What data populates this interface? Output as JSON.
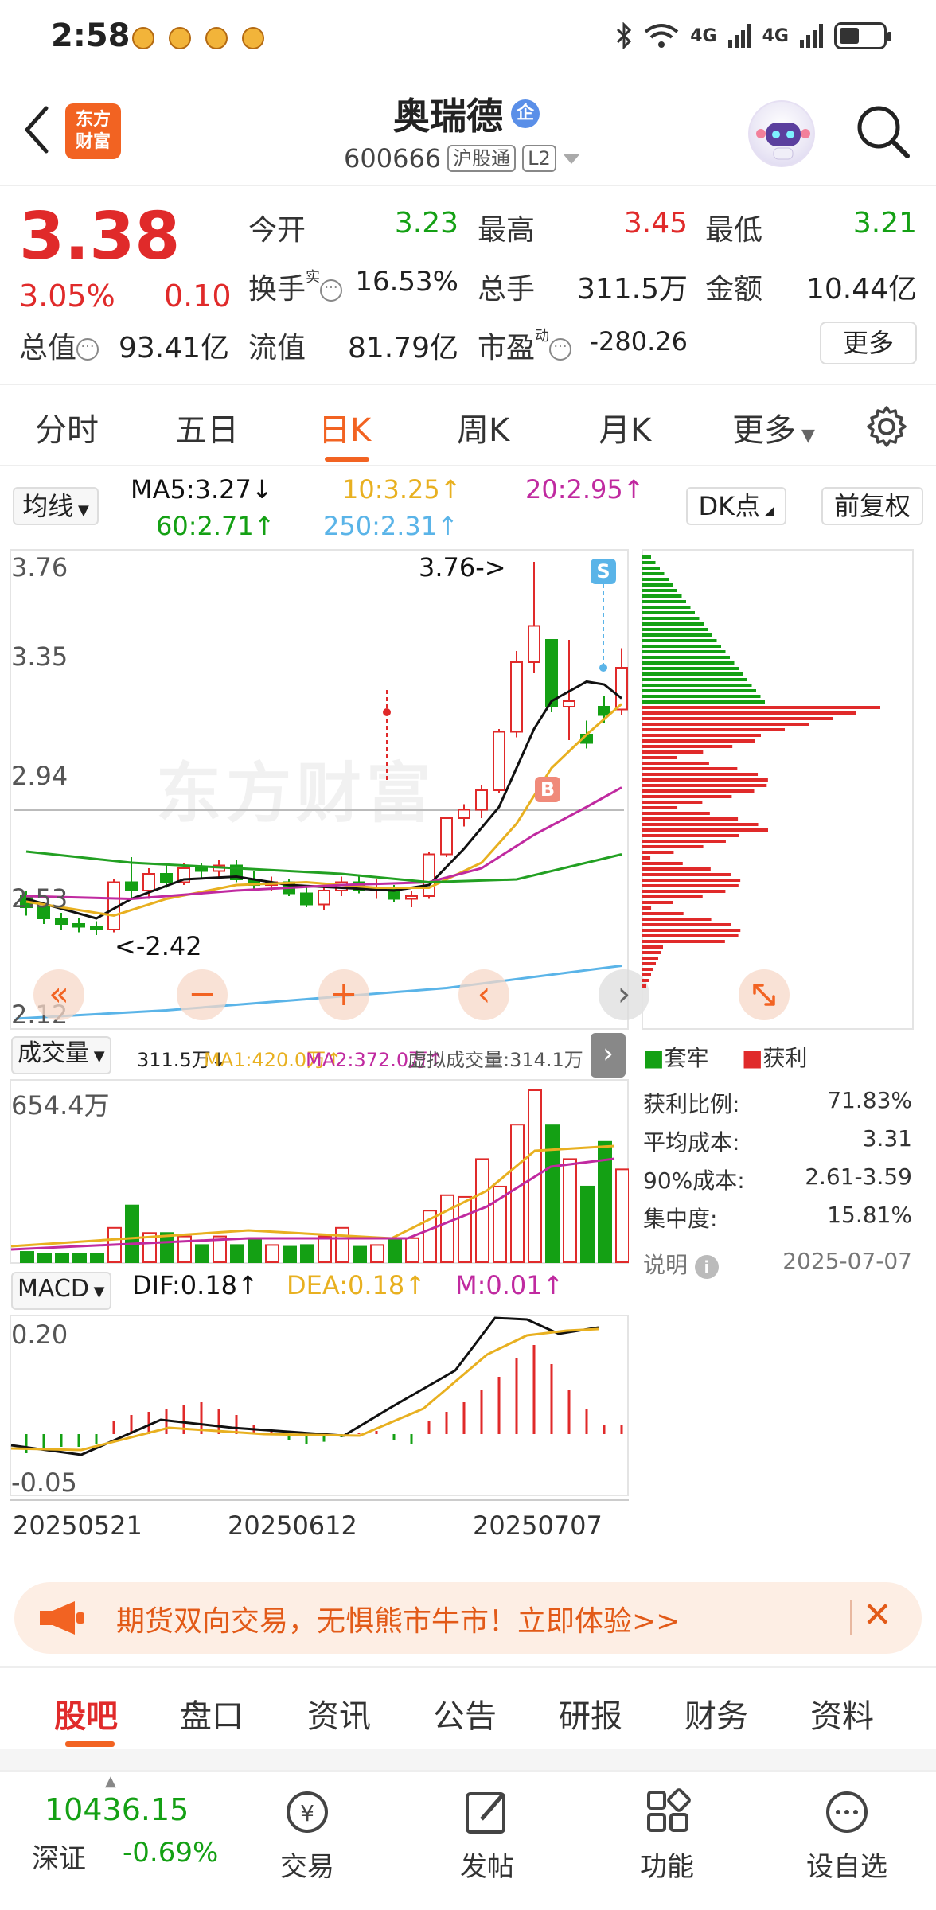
{
  "status_bar": {
    "time": "2:58",
    "signal_1": "4G",
    "signal_2": "4G"
  },
  "header": {
    "logo_line1": "东方",
    "logo_line2": "财富",
    "stock_name": "奥瑞德",
    "badge": "企",
    "stock_code": "600666",
    "tag_connect": "沪股通",
    "tag_level": "L2"
  },
  "quote": {
    "price": "3.38",
    "change_pct": "3.05%",
    "change": "0.10",
    "open_label": "今开",
    "open": "3.23",
    "high_label": "最高",
    "high": "3.45",
    "low_label": "最低",
    "low": "3.21",
    "turnover_label": "换手",
    "turnover_sup": "实",
    "turnover": "16.53%",
    "volume_label": "总手",
    "volume": "311.5万",
    "amount_label": "金额",
    "amount": "10.44亿",
    "mcap_label": "总值",
    "mcap": "93.41亿",
    "float_label": "流值",
    "float": "81.79亿",
    "pe_label": "市盈",
    "pe_sup": "动",
    "pe": "-280.26",
    "more_button": "更多"
  },
  "period_tabs": [
    "分时",
    "五日",
    "日K",
    "周K",
    "月K",
    "更多"
  ],
  "indicators": {
    "ma_select": "均线",
    "ma5": "MA5:3.27",
    "ma10": "10:3.25",
    "ma20": "20:2.95",
    "ma60": "60:2.71",
    "ma250": "250:2.31",
    "dk_button": "DK点",
    "adjust_button": "前复权"
  },
  "kline": {
    "y_ticks": [
      "3.76",
      "3.35",
      "2.94",
      "2.53",
      "2.12"
    ],
    "high_marker": "3.76->",
    "low_marker": "<-2.42",
    "sell_marker": "S",
    "buy_marker": "B",
    "watermark": "东方财富"
  },
  "volume": {
    "select": "成交量",
    "vol": "311.5万",
    "ma1": "MA1:420.0万",
    "ma2": "MA2:372.0万",
    "virtual": "虚拟成交量:314.1万",
    "y_max": "654.4万"
  },
  "macd": {
    "select": "MACD",
    "dif": "DIF:0.18",
    "dea": "DEA:0.18",
    "m": "M:0.01",
    "y_ticks": [
      "0.20",
      "-0.05"
    ],
    "x_ticks": [
      "20250521",
      "20250612",
      "20250707"
    ]
  },
  "chips": {
    "legend_trapped": "套牢",
    "legend_profit": "获利",
    "rows": [
      {
        "label": "获利比例:",
        "value": "71.83%"
      },
      {
        "label": "平均成本:",
        "value": "3.31"
      },
      {
        "label": "90%成本:",
        "value": "2.61-3.59"
      },
      {
        "label": "集中度:",
        "value": "15.81%"
      }
    ],
    "note_label": "说明",
    "date": "2025-07-07"
  },
  "banner": {
    "text": "期货双向交易，无惧熊市牛市！立即体验>>"
  },
  "content_tabs": [
    "股吧",
    "盘口",
    "资讯",
    "公告",
    "研报",
    "财务",
    "资料"
  ],
  "index_ticker": {
    "value": "10436.15",
    "name": "深证",
    "change": "-0.69%"
  },
  "bottom_nav": [
    {
      "label": "交易",
      "icon": "trade-icon"
    },
    {
      "label": "发帖",
      "icon": "post-icon"
    },
    {
      "label": "功能",
      "icon": "function-icon"
    },
    {
      "label": "设自选",
      "icon": "add-watchlist-icon"
    }
  ],
  "colors": {
    "up": "#e02a2a",
    "down": "#14a014",
    "accent": "#f26322",
    "ma5": "#111111",
    "ma10": "#e8b020",
    "ma20": "#c02aa0",
    "ma60": "#22a022",
    "ma250": "#5ab4e8"
  }
}
